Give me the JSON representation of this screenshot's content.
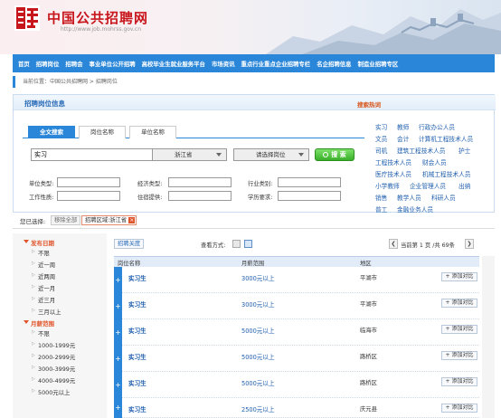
{
  "header": {
    "logo_char": "聘",
    "title": "中国公共招聘网",
    "url": "http://www.job.mohrss.gov.cn"
  },
  "nav": [
    "首页",
    "招聘岗位",
    "招聘会",
    "事业单位公开招聘",
    "高校毕业生就业服务平台",
    "市场资讯",
    "重点行业重点企业招聘专栏",
    "名企招聘信息",
    "制造业招聘专区"
  ],
  "breadcrumb": "当前位置：中国公共招聘网 > 招聘岗位",
  "panel": {
    "title": "招聘岗位信息",
    "hot_title": "搜索热词",
    "tabs": [
      "全文搜索",
      "岗位名称",
      "单位名称"
    ],
    "keyword": "实习",
    "region_select": "浙江省",
    "job_select": "请选择岗位",
    "search_label": "搜 索",
    "filters": {
      "unit_type": "单位类型:",
      "econ_type": "经济类型:",
      "industry": "行业类别:",
      "work_nature": "工作性质:",
      "housing": "住宿提供:",
      "education": "学历要求:"
    }
  },
  "hot_words": [
    [
      "实习",
      "教师",
      "行政办公人员"
    ],
    [
      "文员",
      "会计",
      "计算机工程技术人员"
    ],
    [
      "司机",
      "建筑工程技术人员",
      "护士"
    ],
    [
      "工程技术人员",
      "财会人员"
    ],
    [
      "医疗技术人员",
      "机械工程技术人员"
    ],
    [
      "小学教师",
      "企业管理人员",
      "出纳"
    ],
    [
      "销售",
      "教学人员",
      "科研人员"
    ],
    [
      "普工",
      "金融业务人员"
    ]
  ],
  "selection": {
    "label": "您已选择:",
    "clear": "移除全部",
    "chip": "招聘区域:浙江省"
  },
  "left_filter": {
    "date_head": "发布日期",
    "date_items": [
      "不限",
      "近一周",
      "近两周",
      "近一月",
      "近三月",
      "三月以上"
    ],
    "pay_head": "月薪范围",
    "pay_items": [
      "不限",
      "1000-1999元",
      "2000-2999元",
      "3000-3999元",
      "4000-4999元",
      "5000元以上"
    ]
  },
  "results": {
    "save_label": "招聘关度",
    "view_label": "查看方式:",
    "page_text": "当前第 1 页 /共 69条",
    "columns": [
      "岗位名称",
      "月薪范围",
      "地区"
    ],
    "add_label": "+ 添加对比",
    "rows": [
      {
        "title": "实习生",
        "pay": "3000元以上",
        "area": "平湖市"
      },
      {
        "title": "实习生",
        "pay": "3000元以上",
        "area": "平湖市"
      },
      {
        "title": "实习生",
        "pay": "5000元以上",
        "area": "临海市"
      },
      {
        "title": "实习生",
        "pay": "5000元以上",
        "area": "路桥区"
      },
      {
        "title": "实习生",
        "pay": "5000元以上",
        "area": "路桥区"
      },
      {
        "title": "实习生",
        "pay": "2500元以上",
        "area": "庆元县"
      }
    ]
  }
}
